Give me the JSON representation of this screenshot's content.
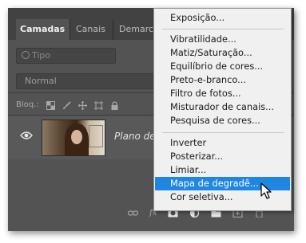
{
  "panel": {
    "tabs": [
      {
        "label": "Camadas",
        "active": true
      },
      {
        "label": "Canais",
        "active": false
      },
      {
        "label": "Demarc",
        "active": false
      }
    ],
    "search_placeholder": "Tipo",
    "blend_mode": "Normal",
    "lock_label": "Bloq.:",
    "layer_name": "Plano de",
    "bottom_icons": [
      "link-icon",
      "fx-icon",
      "mask-icon",
      "adjustment-icon",
      "group-icon",
      "new-layer-icon",
      "trash-icon"
    ],
    "fx_label": "fx"
  },
  "menu": {
    "items": [
      {
        "label": "Exposição..."
      },
      {
        "label": "Vibratilidade..."
      },
      {
        "label": "Matiz/Saturação..."
      },
      {
        "label": "Equilíbrio de cores..."
      },
      {
        "label": "Preto-e-branco..."
      },
      {
        "label": "Filtro de fotos..."
      },
      {
        "label": "Misturador de canais..."
      },
      {
        "label": "Pesquisa de cores..."
      },
      {
        "label": "Inverter"
      },
      {
        "label": "Posterizar..."
      },
      {
        "label": "Limiar..."
      },
      {
        "label": "Mapa de degradê...",
        "selected": true
      },
      {
        "label": "Cor seletiva..."
      }
    ]
  },
  "colors": {
    "panel_bg": "#535353",
    "menu_bg": "#f0f0f0",
    "selection": "#1f86e1"
  }
}
